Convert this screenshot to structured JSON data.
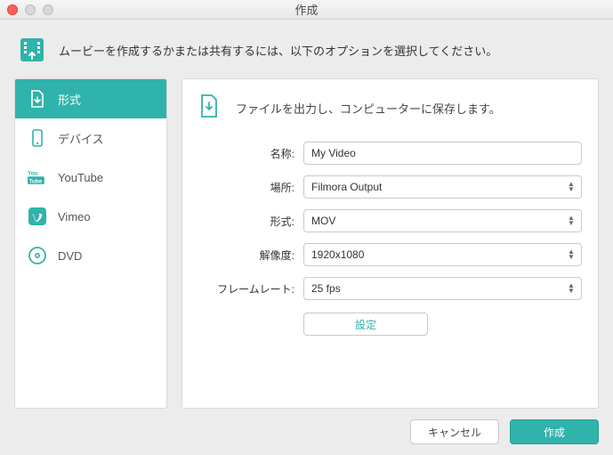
{
  "window": {
    "title": "作成"
  },
  "header": {
    "text": "ムービーを作成するかまたは共有するには、以下のオプションを選択してください。"
  },
  "sidebar": {
    "items": [
      {
        "label": "形式",
        "icon": "file-export-icon",
        "active": true
      },
      {
        "label": "デバイス",
        "icon": "device-icon",
        "active": false
      },
      {
        "label": "YouTube",
        "icon": "youtube-icon",
        "active": false
      },
      {
        "label": "Vimeo",
        "icon": "vimeo-icon",
        "active": false
      },
      {
        "label": "DVD",
        "icon": "disc-icon",
        "active": false
      }
    ]
  },
  "panel": {
    "head_text": "ファイルを出力し、コンピューターに保存します。",
    "fields": {
      "name_label": "名称:",
      "name_value": "My Video",
      "location_label": "場所:",
      "location_value": "Filmora Output",
      "format_label": "形式:",
      "format_value": "MOV",
      "resolution_label": "解像度:",
      "resolution_value": "1920x1080",
      "framerate_label": "フレームレート:",
      "framerate_value": "25 fps",
      "settings_label": "設定"
    }
  },
  "footer": {
    "cancel": "キャンセル",
    "create": "作成"
  },
  "colors": {
    "accent": "#2fb3ab"
  }
}
